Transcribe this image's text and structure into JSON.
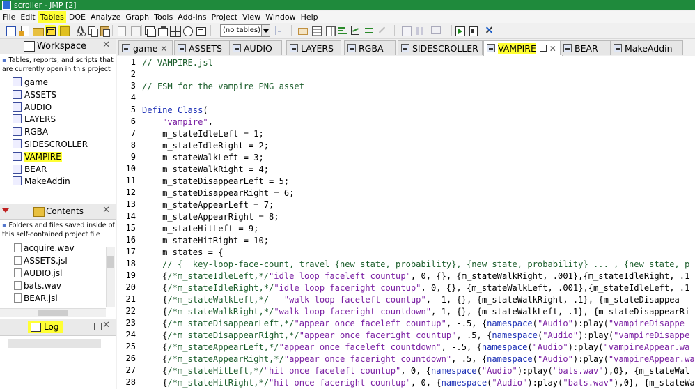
{
  "window": {
    "title": "scroller - JMP [2]"
  },
  "menu": [
    "File",
    "Edit",
    "Tables",
    "DOE",
    "Analyze",
    "Graph",
    "Tools",
    "Add-Ins",
    "Project",
    "View",
    "Window",
    "Help"
  ],
  "toolbar": {
    "table_select": "(no tables)"
  },
  "workspace": {
    "title": "Workspace",
    "hint": "Tables, reports, and scripts that are currently open in this project",
    "items": [
      "game",
      "ASSETS",
      "AUDIO",
      "LAYERS",
      "RGBA",
      "SIDESCROLLER",
      "VAMPIRE",
      "BEAR",
      "MakeAddin"
    ],
    "selected": "VAMPIRE"
  },
  "contents": {
    "title": "Contents",
    "hint": "Folders and files saved inside of this self-contained project file",
    "items": [
      "acquire.wav",
      "ASSETS.jsl",
      "AUDIO.jsl",
      "bats.wav",
      "BEAR.jsl"
    ]
  },
  "log": {
    "title": "Log"
  },
  "tabs": [
    "game",
    "ASSETS",
    "AUDIO",
    "LAYERS",
    "RGBA",
    "SIDESCROLLER",
    "VAMPIRE",
    "BEAR",
    "MakeAddin"
  ],
  "active_tab": "VAMPIRE",
  "highlight_color": "#ffff33",
  "code": {
    "line_numbers": [
      "1",
      "2",
      "3",
      "4",
      "5",
      "6",
      "7",
      "8",
      "9",
      "10",
      "11",
      "12",
      "13",
      "14",
      "15",
      "16",
      "17",
      "18",
      "19",
      "20",
      "21",
      "22",
      "23",
      "24",
      "25",
      "26",
      "27",
      "28"
    ],
    "lines": [
      [
        [
          "com",
          "// VAMPIRE.jsl"
        ]
      ],
      [],
      [
        [
          "com",
          "// FSM for the vampire PNG asset"
        ]
      ],
      [],
      [
        [
          "kw",
          "Define Class"
        ],
        [
          "txt",
          "("
        ]
      ],
      [
        [
          "txt",
          "    "
        ],
        [
          "str",
          "\"vampire\""
        ],
        [
          "txt",
          ","
        ]
      ],
      [
        [
          "txt",
          "    m_stateIdleLeft = 1;"
        ]
      ],
      [
        [
          "txt",
          "    m_stateIdleRight = 2;"
        ]
      ],
      [
        [
          "txt",
          "    m_stateWalkLeft = 3;"
        ]
      ],
      [
        [
          "txt",
          "    m_stateWalkRight = 4;"
        ]
      ],
      [
        [
          "txt",
          "    m_stateDisappearLeft = 5;"
        ]
      ],
      [
        [
          "txt",
          "    m_stateDisappearRight = 6;"
        ]
      ],
      [
        [
          "txt",
          "    m_stateAppearLeft = 7;"
        ]
      ],
      [
        [
          "txt",
          "    m_stateAppearRight = 8;"
        ]
      ],
      [
        [
          "txt",
          "    m_stateHitLeft = 9;"
        ]
      ],
      [
        [
          "txt",
          "    m_stateHitRight = 10;"
        ]
      ],
      [
        [
          "txt",
          "    m_states = {"
        ]
      ],
      [
        [
          "txt",
          "    "
        ],
        [
          "com",
          "// {  key-loop-face-count, travel {new state, probability}, {new state, probability} ... , {new state, p"
        ]
      ],
      [
        [
          "txt",
          "    {"
        ],
        [
          "com",
          "/*m_stateIdleLeft,*/"
        ],
        [
          "str",
          "\"idle loop faceleft countup\""
        ],
        [
          "txt",
          ", 0, {}, {m_stateWalkRight, .001},{m_stateIdleRight, .1"
        ]
      ],
      [
        [
          "txt",
          "    {"
        ],
        [
          "com",
          "/*m_stateIdleRight,*/"
        ],
        [
          "str",
          "\"idle loop faceright countup\""
        ],
        [
          "txt",
          ", 0, {}, {m_stateWalkLeft, .001},{m_stateIdleLeft, .1"
        ]
      ],
      [
        [
          "txt",
          "    {"
        ],
        [
          "com",
          "/*m_stateWalkLeft,*/"
        ],
        [
          "txt",
          "   "
        ],
        [
          "str",
          "\"walk loop faceleft countup\""
        ],
        [
          "txt",
          ", -1, {}, {m_stateWalkRight, .1}, {m_stateDisappea"
        ]
      ],
      [
        [
          "txt",
          "    {"
        ],
        [
          "com",
          "/*m_stateWalkRight,*/"
        ],
        [
          "str",
          "\"walk loop faceright countdown\""
        ],
        [
          "txt",
          ", 1, {}, {m_stateWalkLeft, .1}, {m_stateDisappearRi"
        ]
      ],
      [
        [
          "txt",
          "    {"
        ],
        [
          "com",
          "/*m_stateDisappearLeft,*/"
        ],
        [
          "str",
          "\"appear once faceleft countup\""
        ],
        [
          "txt",
          ", -.5, {"
        ],
        [
          "ns",
          "namespace"
        ],
        [
          "txt",
          "("
        ],
        [
          "str",
          "\"Audio\""
        ],
        [
          "txt",
          "):play("
        ],
        [
          "str",
          "\"vampireDisappe"
        ]
      ],
      [
        [
          "txt",
          "    {"
        ],
        [
          "com",
          "/*m_stateDisappearRight,*/"
        ],
        [
          "str",
          "\"appear once faceright countup\""
        ],
        [
          "txt",
          ", .5, {"
        ],
        [
          "ns",
          "namespace"
        ],
        [
          "txt",
          "("
        ],
        [
          "str",
          "\"Audio\""
        ],
        [
          "txt",
          "):play("
        ],
        [
          "str",
          "\"vampireDisappe"
        ]
      ],
      [
        [
          "txt",
          "    {"
        ],
        [
          "com",
          "/*m_stateAppearLeft,*/"
        ],
        [
          "str",
          "\"appear once faceleft countdown\""
        ],
        [
          "txt",
          ", -.5, {"
        ],
        [
          "ns",
          "namespace"
        ],
        [
          "txt",
          "("
        ],
        [
          "str",
          "\"Audio\""
        ],
        [
          "txt",
          "):play("
        ],
        [
          "str",
          "\"vampireAppear.wa"
        ]
      ],
      [
        [
          "txt",
          "    {"
        ],
        [
          "com",
          "/*m_stateAppearRight,*/"
        ],
        [
          "str",
          "\"appear once faceright countdown\""
        ],
        [
          "txt",
          ", .5, {"
        ],
        [
          "ns",
          "namespace"
        ],
        [
          "txt",
          "("
        ],
        [
          "str",
          "\"Audio\""
        ],
        [
          "txt",
          "):play("
        ],
        [
          "str",
          "\"vampireAppear.wa"
        ]
      ],
      [
        [
          "txt",
          "    {"
        ],
        [
          "com",
          "/*m_stateHitLeft,*/"
        ],
        [
          "str",
          "\"hit once faceleft countup\""
        ],
        [
          "txt",
          ", 0, {"
        ],
        [
          "ns",
          "namespace"
        ],
        [
          "txt",
          "("
        ],
        [
          "str",
          "\"Audio\""
        ],
        [
          "txt",
          "):play("
        ],
        [
          "str",
          "\"bats.wav\""
        ],
        [
          "txt",
          "),0}, {m_stateWal"
        ]
      ],
      [
        [
          "txt",
          "    {"
        ],
        [
          "com",
          "/*m_stateHitRight,*/"
        ],
        [
          "str",
          "\"hit once faceright countup\""
        ],
        [
          "txt",
          ", 0, {"
        ],
        [
          "ns",
          "namespace"
        ],
        [
          "txt",
          "("
        ],
        [
          "str",
          "\"Audio\""
        ],
        [
          "txt",
          "):play("
        ],
        [
          "str",
          "\"bats.wav\""
        ],
        [
          "txt",
          "),0}, {m_stateWal"
        ]
      ]
    ]
  }
}
